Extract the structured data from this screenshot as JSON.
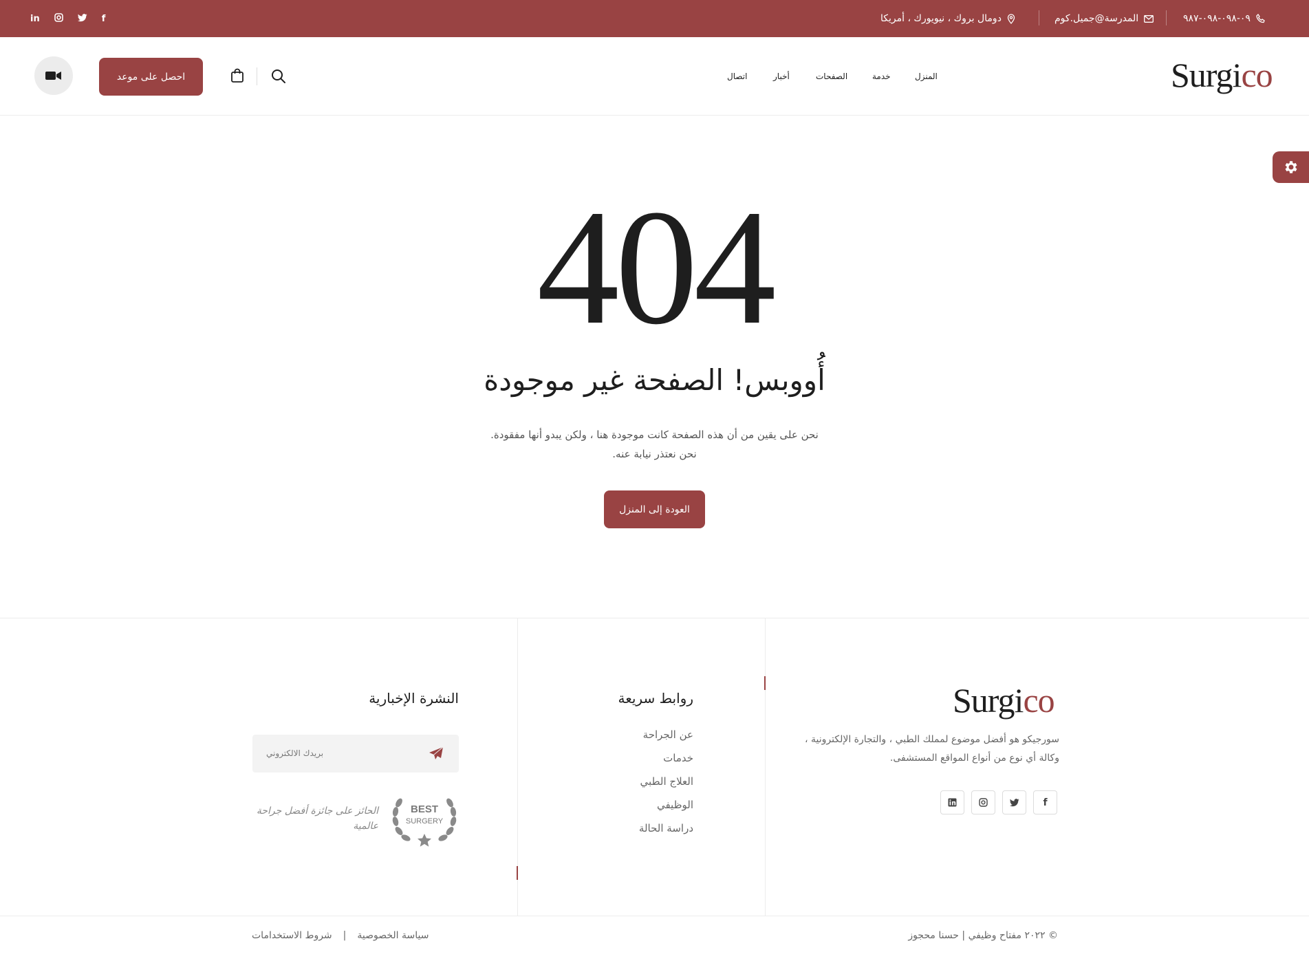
{
  "topbar": {
    "socials": [
      {
        "icon": "linkedin-icon",
        "glyph": "in"
      },
      {
        "icon": "instagram-icon",
        "glyph": "◎"
      },
      {
        "icon": "twitter-icon",
        "glyph": "🐦"
      },
      {
        "icon": "facebook-icon",
        "glyph": "f"
      }
    ],
    "address": "دومال بروك ، نيويورك ، أمريكا",
    "email": "المدرسة@جميل.كوم",
    "phone": "٠٩-٠٩٨-٠٩٨-٩٨٧"
  },
  "header": {
    "logo_main": "Surgi",
    "logo_accent": "co",
    "nav": [
      "المنزل",
      "خدمة",
      "الصفحات",
      "أخبار",
      "اتصال"
    ],
    "cta_label": "احصل على موعد"
  },
  "main": {
    "code": "404",
    "title": "أُووبس! الصفحة غير موجودة",
    "desc_line1": "نحن على يقين من أن هذه الصفحة كانت موجودة هنا ، ولكن يبدو أنها مفقودة.",
    "desc_line2": "نحن نعتذر نيابة عنه.",
    "home_button": "العودة إلى المنزل"
  },
  "footer": {
    "logo_main": "Surgi",
    "logo_accent": "co",
    "about": "سورجيكو هو أفضل موضوع لمملك الطبي ، والتجارة الإلكترونية ، وكالة أي نوع من أنواع المواقع المستشفى.",
    "quick_links_title": "روابط سريعة",
    "quick_links": [
      "عن الجراحة",
      "خدمات",
      "العلاج الطبي",
      "الوظيفي",
      "دراسة الحالة"
    ],
    "newsletter_title": "النشرة الإخبارية",
    "newsletter_placeholder": "بريدك الالكتروني",
    "badge_top": "BEST",
    "badge_bottom": "SURGERY",
    "award_text": "الحائز على جائزة أفضل جراحة عالمية",
    "copyright": "© ٢٠٢٢ مفتاح وظيفي | حسنا محجوز",
    "privacy": "سياسة الخصوصية",
    "terms": "شروط الاستخدامات",
    "legal_sep": "|"
  },
  "colors": {
    "accent": "#994343",
    "text": "#1e1e1e",
    "muted": "#666666"
  }
}
